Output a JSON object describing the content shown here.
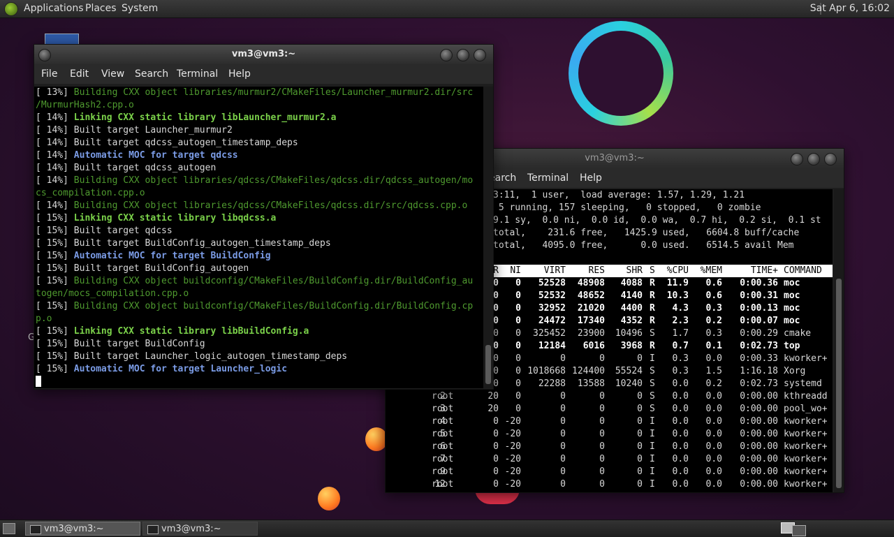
{
  "top_panel": {
    "menus": [
      "Applications",
      "Places",
      "System"
    ],
    "clock": "Sat Apr  6, 16:02"
  },
  "desktop": {
    "letter": "G"
  },
  "window1": {
    "title": "vm3@vm3:~",
    "menu": [
      "File",
      "Edit",
      "View",
      "Search",
      "Terminal",
      "Help"
    ],
    "lines": [
      {
        "p": "[ 13%] ",
        "t": "Building CXX object libraries/murmur2/CMakeFiles/Launcher_murmur2.dir/src",
        "s": "g"
      },
      {
        "p": "",
        "t": "/MurmurHash2.cpp.o",
        "s": "g"
      },
      {
        "p": "[ 14%] ",
        "t": "Linking CXX static library libLauncher_murmur2.a",
        "s": "lg"
      },
      {
        "p": "[ 14%] ",
        "t": "Built target Launcher_murmur2",
        "s": ""
      },
      {
        "p": "[ 14%] ",
        "t": "Built target qdcss_autogen_timestamp_deps",
        "s": ""
      },
      {
        "p": "[ 14%] ",
        "t": "Automatic MOC for target qdcss",
        "s": "bl"
      },
      {
        "p": "[ 14%] ",
        "t": "Built target qdcss_autogen",
        "s": ""
      },
      {
        "p": "[ 14%] ",
        "t": "Building CXX object libraries/qdcss/CMakeFiles/qdcss.dir/qdcss_autogen/mo",
        "s": "g"
      },
      {
        "p": "",
        "t": "cs_compilation.cpp.o",
        "s": "g"
      },
      {
        "p": "[ 14%] ",
        "t": "Building CXX object libraries/qdcss/CMakeFiles/qdcss.dir/src/qdcss.cpp.o",
        "s": "g"
      },
      {
        "p": "[ 15%] ",
        "t": "Linking CXX static library libqdcss.a",
        "s": "lg"
      },
      {
        "p": "[ 15%] ",
        "t": "Built target qdcss",
        "s": ""
      },
      {
        "p": "[ 15%] ",
        "t": "Built target BuildConfig_autogen_timestamp_deps",
        "s": ""
      },
      {
        "p": "[ 15%] ",
        "t": "Automatic MOC for target BuildConfig",
        "s": "bl"
      },
      {
        "p": "[ 15%] ",
        "t": "Built target BuildConfig_autogen",
        "s": ""
      },
      {
        "p": "[ 15%] ",
        "t": "Building CXX object buildconfig/CMakeFiles/BuildConfig.dir/BuildConfig_au",
        "s": "g"
      },
      {
        "p": "",
        "t": "togen/mocs_compilation.cpp.o",
        "s": "g"
      },
      {
        "p": "[ 15%] ",
        "t": "Building CXX object buildconfig/CMakeFiles/BuildConfig.dir/BuildConfig.cp",
        "s": "g"
      },
      {
        "p": "",
        "t": "p.o",
        "s": "g"
      },
      {
        "p": "[ 15%] ",
        "t": "Linking CXX static library libBuildConfig.a",
        "s": "lg"
      },
      {
        "p": "[ 15%] ",
        "t": "Built target BuildConfig",
        "s": ""
      },
      {
        "p": "[ 15%] ",
        "t": "Built target Launcher_logic_autogen_timestamp_deps",
        "s": ""
      },
      {
        "p": "[ 15%] ",
        "t": "Automatic MOC for target Launcher_logic",
        "s": "bl"
      }
    ]
  },
  "window2": {
    "title": "vm3@vm3:~",
    "menu": [
      "earch",
      "Terminal",
      "Help"
    ],
    "summary": [
      "3:11,  1 user,  load average: 1.57, 1.29, 1.21",
      " 5 running, 157 sleeping,   0 stopped,   0 zombie",
      "9.1 sy,  0.0 ni,  0.0 id,  0.0 wa,  0.7 hi,  0.2 si,  0.1 st",
      "total,    231.6 free,   1425.9 used,   6604.8 buff/cache",
      "total,   4095.0 free,      0.0 used.   6514.5 avail Mem"
    ],
    "header": [
      "R",
      "NI",
      "VIRT",
      "RES",
      "SHR",
      "S",
      "%CPU",
      "%MEM",
      "TIME+",
      "COMMAND"
    ],
    "rows": [
      {
        "pid": "",
        "user": "",
        "pr": "0",
        "ni": "0",
        "virt": "52528",
        "res": "48908",
        "shr": "4088",
        "s": "R",
        "cpu": "11.9",
        "mem": "0.6",
        "time": "0:00.36",
        "cmd": "moc",
        "bold": true
      },
      {
        "pid": "",
        "user": "",
        "pr": "0",
        "ni": "0",
        "virt": "52532",
        "res": "48652",
        "shr": "4140",
        "s": "R",
        "cpu": "10.3",
        "mem": "0.6",
        "time": "0:00.31",
        "cmd": "moc",
        "bold": true
      },
      {
        "pid": "",
        "user": "",
        "pr": "0",
        "ni": "0",
        "virt": "32952",
        "res": "21020",
        "shr": "4400",
        "s": "R",
        "cpu": "4.3",
        "mem": "0.3",
        "time": "0:00.13",
        "cmd": "moc",
        "bold": true
      },
      {
        "pid": "",
        "user": "",
        "pr": "0",
        "ni": "0",
        "virt": "24472",
        "res": "17340",
        "shr": "4352",
        "s": "R",
        "cpu": "2.3",
        "mem": "0.2",
        "time": "0:00.07",
        "cmd": "moc",
        "bold": true
      },
      {
        "pid": "",
        "user": "",
        "pr": "0",
        "ni": "0",
        "virt": "325452",
        "res": "23900",
        "shr": "10496",
        "s": "S",
        "cpu": "1.7",
        "mem": "0.3",
        "time": "0:00.29",
        "cmd": "cmake",
        "bold": false
      },
      {
        "pid": "",
        "user": "",
        "pr": "0",
        "ni": "0",
        "virt": "12184",
        "res": "6016",
        "shr": "3968",
        "s": "R",
        "cpu": "0.7",
        "mem": "0.1",
        "time": "0:02.73",
        "cmd": "top",
        "bold": true
      },
      {
        "pid": "",
        "user": "",
        "pr": "0",
        "ni": "0",
        "virt": "0",
        "res": "0",
        "shr": "0",
        "s": "I",
        "cpu": "0.3",
        "mem": "0.0",
        "time": "0:00.33",
        "cmd": "kworker+",
        "bold": false
      },
      {
        "pid": "",
        "user": "",
        "pr": "0",
        "ni": "0",
        "virt": "1018668",
        "res": "124400",
        "shr": "55524",
        "s": "S",
        "cpu": "0.3",
        "mem": "1.5",
        "time": "1:16.18",
        "cmd": "Xorg",
        "bold": false
      },
      {
        "pid": "",
        "user": "",
        "pr": "0",
        "ni": "0",
        "virt": "22288",
        "res": "13588",
        "shr": "10240",
        "s": "S",
        "cpu": "0.0",
        "mem": "0.2",
        "time": "0:02.73",
        "cmd": "systemd",
        "bold": false
      },
      {
        "pid": "2",
        "user": "root",
        "pr": "20",
        "ni": "0",
        "virt": "0",
        "res": "0",
        "shr": "0",
        "s": "S",
        "cpu": "0.0",
        "mem": "0.0",
        "time": "0:00.00",
        "cmd": "kthreadd",
        "bold": false
      },
      {
        "pid": "3",
        "user": "root",
        "pr": "20",
        "ni": "0",
        "virt": "0",
        "res": "0",
        "shr": "0",
        "s": "S",
        "cpu": "0.0",
        "mem": "0.0",
        "time": "0:00.00",
        "cmd": "pool_wo+",
        "bold": false
      },
      {
        "pid": "4",
        "user": "root",
        "pr": "0",
        "ni": "-20",
        "virt": "0",
        "res": "0",
        "shr": "0",
        "s": "I",
        "cpu": "0.0",
        "mem": "0.0",
        "time": "0:00.00",
        "cmd": "kworker+",
        "bold": false
      },
      {
        "pid": "5",
        "user": "root",
        "pr": "0",
        "ni": "-20",
        "virt": "0",
        "res": "0",
        "shr": "0",
        "s": "I",
        "cpu": "0.0",
        "mem": "0.0",
        "time": "0:00.00",
        "cmd": "kworker+",
        "bold": false
      },
      {
        "pid": "6",
        "user": "root",
        "pr": "0",
        "ni": "-20",
        "virt": "0",
        "res": "0",
        "shr": "0",
        "s": "I",
        "cpu": "0.0",
        "mem": "0.0",
        "time": "0:00.00",
        "cmd": "kworker+",
        "bold": false
      },
      {
        "pid": "7",
        "user": "root",
        "pr": "0",
        "ni": "-20",
        "virt": "0",
        "res": "0",
        "shr": "0",
        "s": "I",
        "cpu": "0.0",
        "mem": "0.0",
        "time": "0:00.00",
        "cmd": "kworker+",
        "bold": false
      },
      {
        "pid": "9",
        "user": "root",
        "pr": "0",
        "ni": "-20",
        "virt": "0",
        "res": "0",
        "shr": "0",
        "s": "I",
        "cpu": "0.0",
        "mem": "0.0",
        "time": "0:00.00",
        "cmd": "kworker+",
        "bold": false
      },
      {
        "pid": "12",
        "user": "root",
        "pr": "0",
        "ni": "-20",
        "virt": "0",
        "res": "0",
        "shr": "0",
        "s": "I",
        "cpu": "0.0",
        "mem": "0.0",
        "time": "0:00.00",
        "cmd": "kworker+",
        "bold": false
      }
    ]
  },
  "taskbar": {
    "tasks": [
      "vm3@vm3:~",
      "vm3@vm3:~"
    ]
  },
  "colors": {
    "build_green": "#4f9a2f",
    "link_green": "#7bd24a",
    "moc_blue": "#7b9ce6"
  }
}
